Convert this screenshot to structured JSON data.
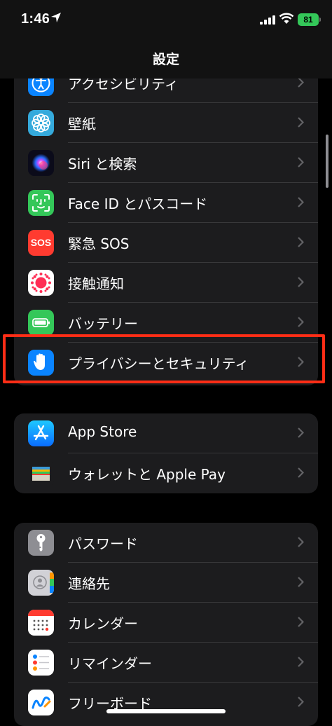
{
  "status_bar": {
    "time": "1:46",
    "battery": "81",
    "battery_color": "#34c759"
  },
  "header": {
    "title": "設定"
  },
  "groups": [
    {
      "items": [
        {
          "label": "アクセシビリティ",
          "icon": "accessibility-icon",
          "color": "#0a84ff"
        },
        {
          "label": "壁紙",
          "icon": "wallpaper-icon",
          "color": "#35aadc"
        },
        {
          "label": "Siri と検索",
          "icon": "siri-icon",
          "color": "#1a1a2e"
        },
        {
          "label": "Face ID とパスコード",
          "icon": "face-id-icon",
          "color": "#34c759"
        },
        {
          "label": "緊急 SOS",
          "icon": "sos-icon",
          "color": "#ff3b30",
          "icon_text": "SOS"
        },
        {
          "label": "接触通知",
          "icon": "exposure-notification-icon",
          "color": "#ffffff"
        },
        {
          "label": "バッテリー",
          "icon": "battery-icon",
          "color": "#34c759"
        },
        {
          "label": "プライバシーとセキュリティ",
          "icon": "privacy-hand-icon",
          "color": "#0a84ff"
        }
      ]
    },
    {
      "items": [
        {
          "label": "App Store",
          "icon": "app-store-icon",
          "color": "#0a84ff"
        },
        {
          "label": "ウォレットと Apple Pay",
          "icon": "wallet-icon",
          "color": "#1c1c1e"
        }
      ]
    },
    {
      "items": [
        {
          "label": "パスワード",
          "icon": "key-icon",
          "color": "#8e8e93"
        },
        {
          "label": "連絡先",
          "icon": "contacts-icon",
          "color": "#c7c7cc"
        },
        {
          "label": "カレンダー",
          "icon": "calendar-icon",
          "color": "#ffffff"
        },
        {
          "label": "リマインダー",
          "icon": "reminders-icon",
          "color": "#ffffff"
        },
        {
          "label": "フリーボード",
          "icon": "freeform-icon",
          "color": "#ffffff"
        }
      ]
    }
  ],
  "highlight_color": "#ff2d16"
}
